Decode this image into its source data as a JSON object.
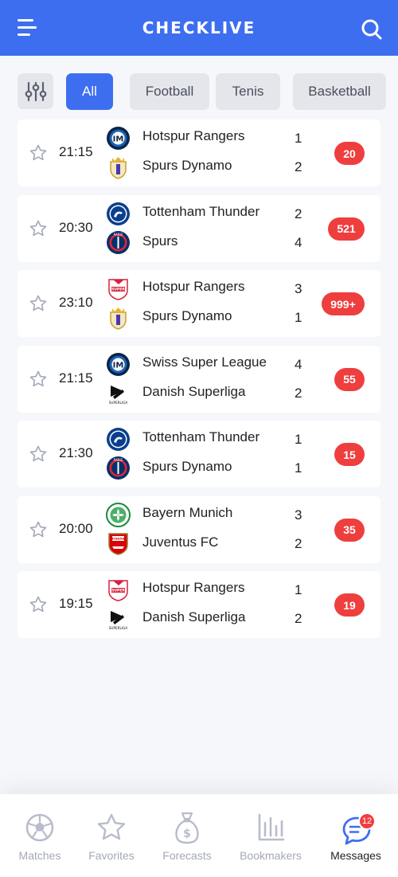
{
  "app": {
    "title": "CHECKLIVE"
  },
  "tabs": [
    {
      "label": "All",
      "active": true
    },
    {
      "label": "Football",
      "active": false
    },
    {
      "label": "Tenis",
      "active": false
    },
    {
      "label": "Basketball",
      "active": false
    }
  ],
  "matches": [
    {
      "time": "21:15",
      "home": {
        "name": "Hotspur Rangers",
        "logo": "inter-logo",
        "score": "1"
      },
      "away": {
        "name": "Spurs Dynamo",
        "logo": "real-madrid-logo",
        "score": "2"
      },
      "count": "20"
    },
    {
      "time": "20:30",
      "home": {
        "name": "Tottenham Thunder",
        "logo": "chelsea-logo",
        "score": "2"
      },
      "away": {
        "name": "Spurs",
        "logo": "psg-logo",
        "score": "4"
      },
      "count": "521"
    },
    {
      "time": "23:10",
      "home": {
        "name": "Hotspur Rangers",
        "logo": "swiss-super-league-logo",
        "score": "3"
      },
      "away": {
        "name": "Spurs Dynamo",
        "logo": "real-madrid-logo",
        "score": "1"
      },
      "count": "999+"
    },
    {
      "time": "21:15",
      "home": {
        "name": "Swiss Super League",
        "logo": "inter-logo",
        "score": "4"
      },
      "away": {
        "name": "Danish Superliga",
        "logo": "superliga-logo",
        "score": "2"
      },
      "count": "55"
    },
    {
      "time": "21:30",
      "home": {
        "name": "Tottenham Thunder",
        "logo": "chelsea-logo",
        "score": "1"
      },
      "away": {
        "name": "Spurs Dynamo",
        "logo": "psg-logo",
        "score": "1"
      },
      "count": "15"
    },
    {
      "time": "20:00",
      "home": {
        "name": "Bayern Munich",
        "logo": "celtic-logo",
        "score": "3"
      },
      "away": {
        "name": "Juventus FC",
        "logo": "arsenal-logo",
        "score": "2"
      },
      "count": "35"
    },
    {
      "time": "19:15",
      "home": {
        "name": "Hotspur Rangers",
        "logo": "swiss-super-league-logo",
        "score": "1"
      },
      "away": {
        "name": "Danish Superliga",
        "logo": "superliga-logo",
        "score": "2"
      },
      "count": "19"
    }
  ],
  "nav": [
    {
      "label": "Matches",
      "icon": "soccer-ball-icon",
      "active": false
    },
    {
      "label": "Favorites",
      "icon": "star-icon",
      "active": false
    },
    {
      "label": "Forecasts",
      "icon": "money-bag-icon",
      "active": false
    },
    {
      "label": "Bookmakers",
      "icon": "bar-chart-icon",
      "active": false
    },
    {
      "label": "Messages",
      "icon": "chat-icon",
      "active": true,
      "badge": "12"
    }
  ],
  "colors": {
    "accent": "#3e6ef0",
    "badge": "#ef3e3e",
    "muted": "#a3a8b8",
    "background": "#f6f7fb"
  }
}
